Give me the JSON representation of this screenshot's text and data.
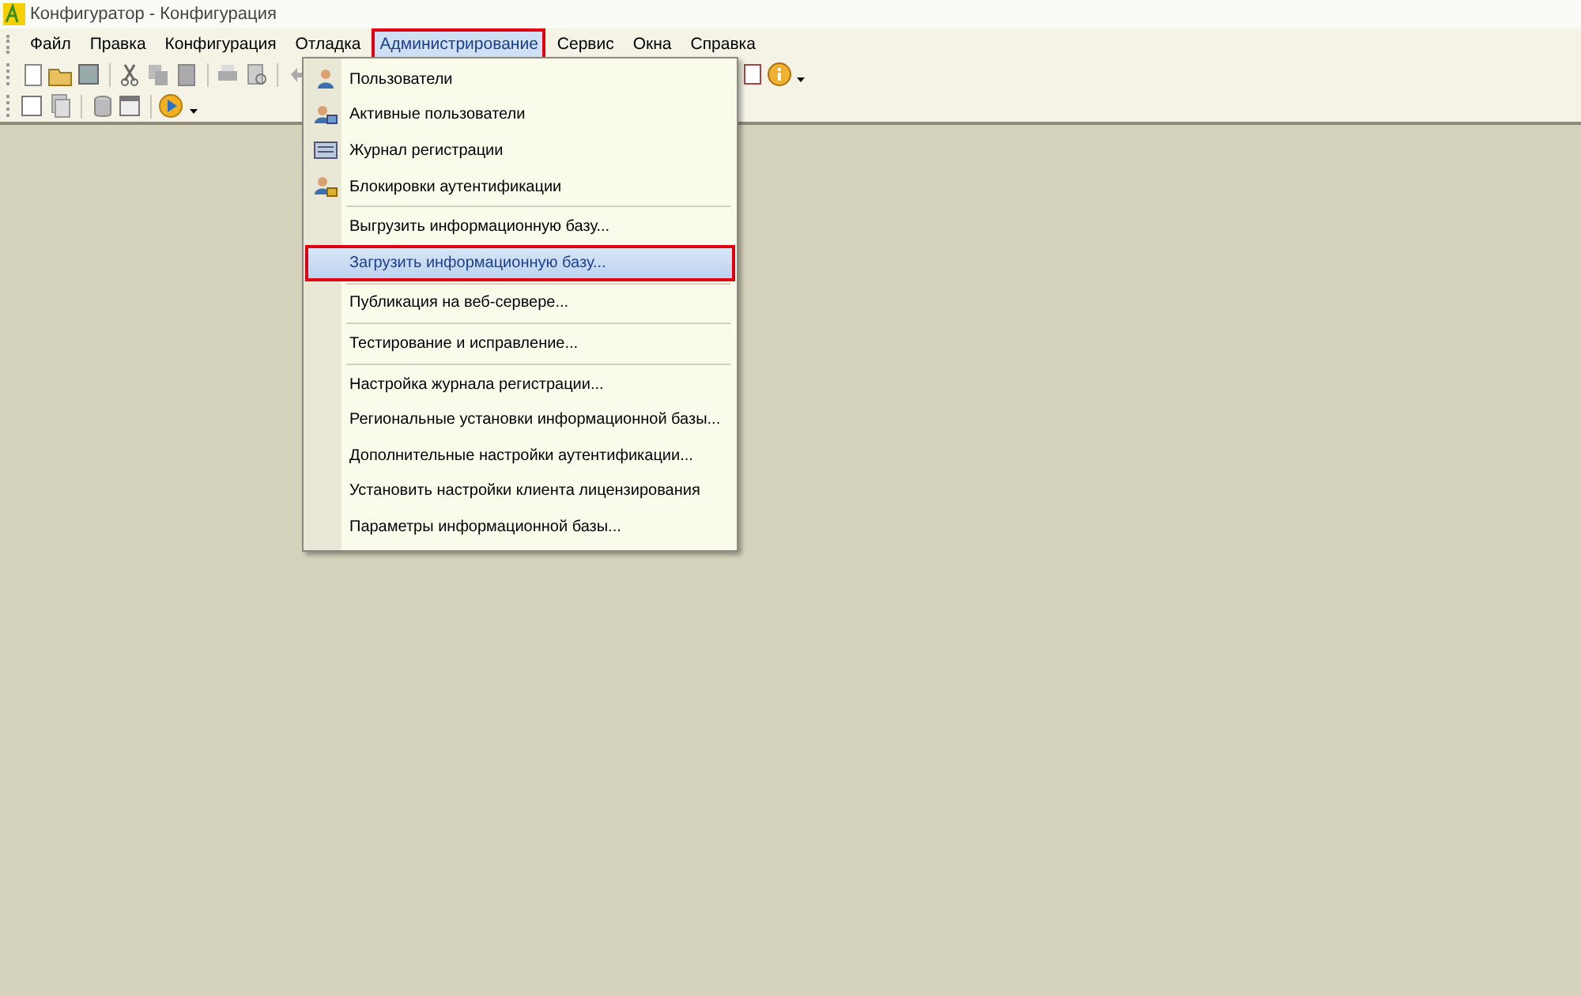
{
  "window": {
    "title": "Конфигуратор - Конфигурация"
  },
  "menu_bar": [
    {
      "label": "Файл",
      "selected": false,
      "outlined": false
    },
    {
      "label": "Правка",
      "selected": false,
      "outlined": false
    },
    {
      "label": "Конфигурация",
      "selected": false,
      "outlined": false
    },
    {
      "label": "Отладка",
      "selected": false,
      "outlined": false
    },
    {
      "label": "Администрирование",
      "selected": true,
      "outlined": true
    },
    {
      "label": "Сервис",
      "selected": false,
      "outlined": false
    },
    {
      "label": "Окна",
      "selected": false,
      "outlined": false
    },
    {
      "label": "Справка",
      "selected": false,
      "outlined": false
    }
  ],
  "dropdown": {
    "groups": [
      [
        {
          "label": "Пользователи",
          "selected": false,
          "outlined": false
        },
        {
          "label": "Активные пользователи",
          "selected": false,
          "outlined": false
        },
        {
          "label": "Журнал регистрации",
          "selected": false,
          "outlined": false
        },
        {
          "label": "Блокировки аутентификации",
          "selected": false,
          "outlined": false
        }
      ],
      [
        {
          "label": "Выгрузить информационную базу...",
          "selected": false,
          "outlined": false
        },
        {
          "label": "Загрузить информационную базу...",
          "selected": true,
          "outlined": true
        }
      ],
      [
        {
          "label": "Публикация на веб-сервере...",
          "selected": false,
          "outlined": false
        }
      ],
      [
        {
          "label": "Тестирование и исправление...",
          "selected": false,
          "outlined": false
        }
      ],
      [
        {
          "label": "Настройка журнала регистрации...",
          "selected": false,
          "outlined": false
        },
        {
          "label": "Региональные установки информационной базы...",
          "selected": false,
          "outlined": false
        },
        {
          "label": "Дополнительные настройки аутентификации...",
          "selected": false,
          "outlined": false
        },
        {
          "label": "Установить настройки клиента лицензирования",
          "selected": false,
          "outlined": false
        },
        {
          "label": "Параметры информационной базы...",
          "selected": false,
          "outlined": false
        }
      ]
    ]
  }
}
